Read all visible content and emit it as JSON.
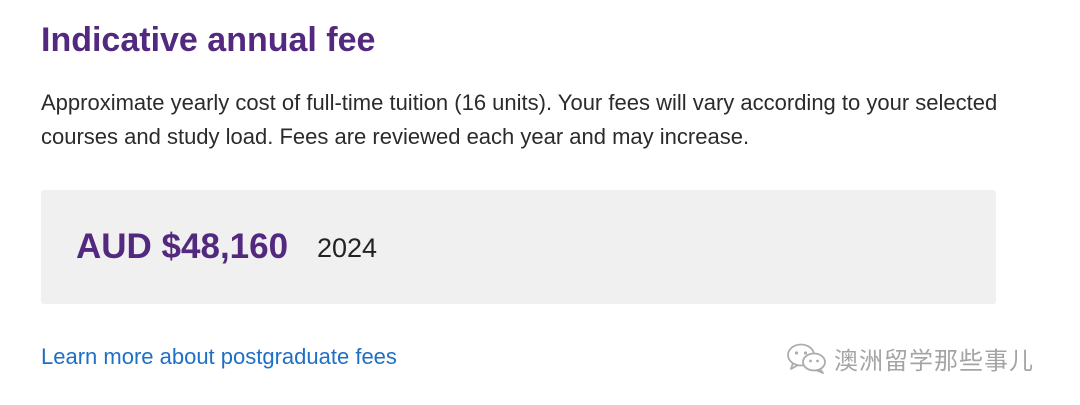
{
  "section": {
    "title": "Indicative annual fee",
    "description": "Approximate yearly cost of full-time tuition (16 units). Your fees will vary according to your selected courses and study load. Fees are reviewed each year and may increase."
  },
  "fee": {
    "amount": "AUD $48,160",
    "year": "2024"
  },
  "link": {
    "label": "Learn more about postgraduate fees"
  },
  "watermark": {
    "text": "澳洲留学那些事儿",
    "icon": "wechat-icon"
  },
  "colors": {
    "heading": "#52297f",
    "link": "#1f6fc5",
    "fee_box_background": "#f0f0f0"
  }
}
